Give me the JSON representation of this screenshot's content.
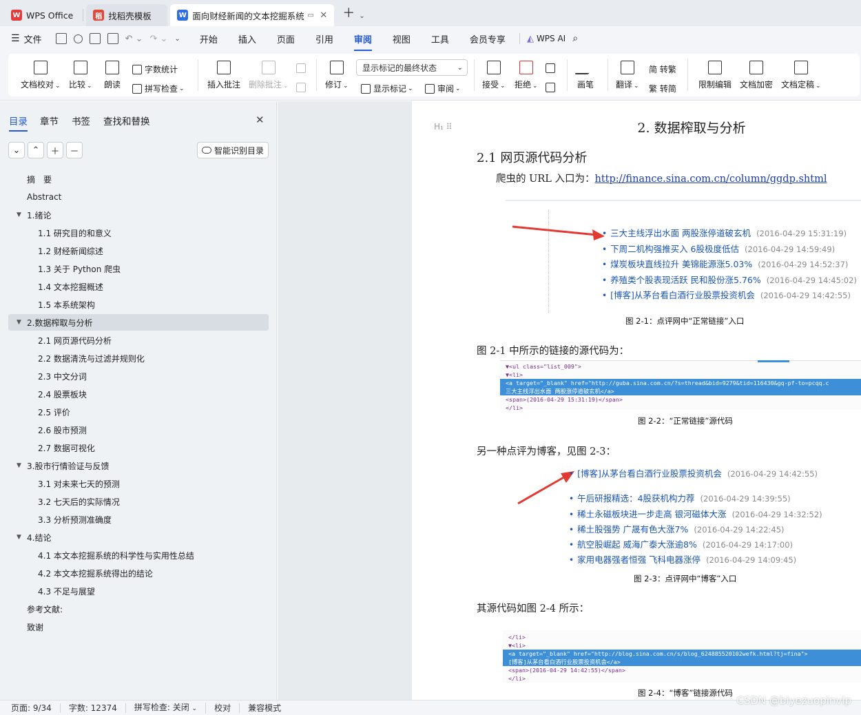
{
  "tabs": [
    {
      "label": "WPS Office",
      "logo": "W"
    },
    {
      "label": "找稻壳模板",
      "logo": "稻"
    },
    {
      "label": "面向财经新闻的文本挖掘系统",
      "logo": "W"
    }
  ],
  "menu": {
    "file": "文件",
    "items": [
      "开始",
      "插入",
      "页面",
      "引用",
      "审阅",
      "视图",
      "工具",
      "会员专享"
    ],
    "active": "审阅",
    "wps_ai": "WPS AI"
  },
  "ribbon": {
    "doc_check": "文档校对",
    "compare": "比较",
    "read_aloud": "朗读",
    "word_count": "字数统计",
    "spell_check": "拼写检查",
    "insert_comment": "插入批注",
    "delete_comment": "删除批注",
    "revise": "修订",
    "markup_state": "显示标记的最终状态",
    "show_markup": "显示标记",
    "review": "审阅",
    "accept": "接受",
    "reject": "拒绝",
    "pen": "画笔",
    "translate": "翻译",
    "to_traditional": "简 转繁",
    "to_simplified": "繁 转简",
    "restrict_edit": "限制编辑",
    "encrypt": "文档加密",
    "finalize": "文档定稿"
  },
  "nav": {
    "tabs": [
      "目录",
      "章节",
      "书签",
      "查找和替换"
    ],
    "smart_toc": "智能识别目录",
    "toc": [
      {
        "label": "摘　要",
        "level": 0
      },
      {
        "label": "Abstract",
        "level": 0
      },
      {
        "label": "1.绪论",
        "level": 0,
        "expand": true
      },
      {
        "label": "1.1  研究目的和意义",
        "level": 1
      },
      {
        "label": "1.2  财经新闻综述",
        "level": 1
      },
      {
        "label": "1.3  关于 Python 爬虫",
        "level": 1
      },
      {
        "label": "1.4  文本挖掘概述",
        "level": 1
      },
      {
        "label": "1.5 本系统架构",
        "level": 1
      },
      {
        "label": "2.数据榨取与分析",
        "level": 0,
        "expand": true,
        "selected": true
      },
      {
        "label": "2.1  网页源代码分析",
        "level": 1
      },
      {
        "label": "2.2  数据清洗与过滤并规则化",
        "level": 1
      },
      {
        "label": "2.3  中文分词",
        "level": 1
      },
      {
        "label": "2.4  股票板块",
        "level": 1
      },
      {
        "label": "2.5  评价",
        "level": 1
      },
      {
        "label": "2.6  股市预测",
        "level": 1
      },
      {
        "label": "2.7  数据可视化",
        "level": 1
      },
      {
        "label": "3.股市行情验证与反馈",
        "level": 0,
        "expand": true
      },
      {
        "label": "3.1  对未来七天的预测",
        "level": 1
      },
      {
        "label": "3.2  七天后的实际情况",
        "level": 1
      },
      {
        "label": "3.3  分析预测准确度",
        "level": 1
      },
      {
        "label": "4.结论",
        "level": 0,
        "expand": true
      },
      {
        "label": "4.1  本文本挖掘系统的科学性与实用性总结",
        "level": 1
      },
      {
        "label": "4.2  本文本挖掘系统得出的结论",
        "level": 1
      },
      {
        "label": "4.3  不足与展望",
        "level": 1
      },
      {
        "label": "参考文献:",
        "level": 0
      },
      {
        "label": "致谢",
        "level": 0
      }
    ]
  },
  "doc": {
    "heading": "2. 数据榨取与分析",
    "subheading": "2.1  网页源代码分析",
    "entry_text": "爬虫的 URL 入口为：",
    "entry_url": "http://finance.sina.com.cn/column/ggdp.shtml",
    "fig1": [
      {
        "title": "三大主线浮出水面 两股涨停道破玄机",
        "date": "(2016-04-29 15:31:19)"
      },
      {
        "title": "下周二机构强推买入 6股极度低估",
        "date": "(2016-04-29 14:59:49)"
      },
      {
        "title": "煤炭板块直线拉升 美锦能源涨5.03%",
        "date": "(2016-04-29 14:52:37)"
      },
      {
        "title": "养殖类个股表现活跃 民和股份涨5.76%",
        "date": "(2016-04-29 14:45:02)"
      },
      {
        "title": "[博客]从茅台看白酒行业股票投资机会",
        "date": "(2016-04-29 14:42:55)"
      }
    ],
    "fig1_caption": "图 2-1：点评网中“正常链接”入口",
    "para2": "图 2-1 中所示的链接的源代码为：",
    "fig2_code": [
      "▼<ul class=\"list_009\">",
      "  ▼<li>",
      "     <a target=\"_blank\" href=\"http://guba.sina.com.cn/?s=thread&bid=9279&tid=116430&gq-pf-to=pcqq.c",
      "     三大主线浮出水面 两股涨停道破玄机</a>",
      "     <span>(2016-04-29 15:31:19)</span>",
      "   </li>"
    ],
    "fig2_caption": "图 2-2：“正常链接”源代码",
    "para3": "另一种点评为博客，见图 2-3：",
    "fig3": [
      {
        "title": "[博客]从茅台看白酒行业股票投资机会",
        "date": "(2016-04-29 14:42:55)"
      },
      {
        "title": "午后研报精选：4股获机构力荐",
        "date": "(2016-04-29 14:39:55)"
      },
      {
        "title": "稀土永磁板块进一步走高 银河磁体大涨",
        "date": "(2016-04-29 14:32:52)"
      },
      {
        "title": "稀土股强势 广晟有色大涨7%",
        "date": "(2016-04-29 14:22:45)"
      },
      {
        "title": "航空股崛起 威海广泰大涨逾8%",
        "date": "(2016-04-29 14:17:00)"
      },
      {
        "title": "家用电器强者恒强 飞科电器涨停",
        "date": "(2016-04-29 14:09:45)"
      }
    ],
    "fig3_caption": "图 2-3：点评网中“博客”入口",
    "para4": "其源代码如图 2-4 所示：",
    "fig4_code": [
      "</li>",
      "▼<li>",
      "   <a target=\"_blank\" href=\"http://blog.sina.com.cn/s/blog_624885520102wefk.html?tj=fina\">",
      "   [博客]从茅台看白酒行业股票投资机会</a>",
      "   <span>(2016-04-29 14:42:55)</span>",
      "</li>"
    ],
    "fig4_caption": "图 2-4：“博客”链接源代码"
  },
  "status": {
    "page": "页面: 9/34",
    "words": "字数: 12374",
    "spell": "拼写检查: 关闭",
    "proof": "校对",
    "compat": "兼容模式"
  },
  "watermark": "CSDN @biyezuopinvip",
  "colors": {
    "accent": "#2358d8",
    "link": "#1a55b3",
    "highlight": "#3d8fd8",
    "arrow": "#e23a32"
  }
}
